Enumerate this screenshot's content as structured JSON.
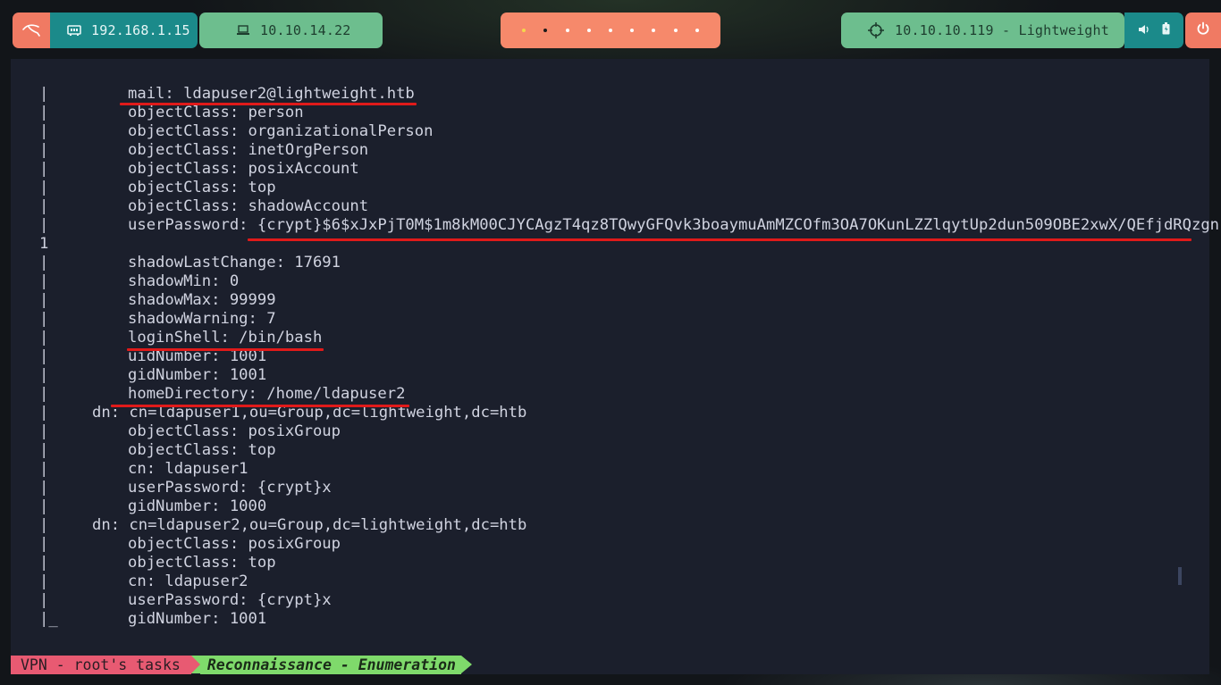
{
  "topbar": {
    "kali_icon": "kali-dragon-icon",
    "local_ip": "192.168.1.15",
    "vpn_ip": "10.10.14.22",
    "workspaces_count": 9,
    "active_workspace": 2,
    "target": "10.10.10.119 - Lightweight",
    "volume_icon": "volume-icon",
    "battery_icon": "battery-icon",
    "power_icon": "power-icon"
  },
  "terminal": {
    "lines": [
      {
        "bar": "|",
        "indent": 2,
        "text": "mail: ldapuser2@lightweight.htb"
      },
      {
        "bar": "|",
        "indent": 2,
        "text": "objectClass: person"
      },
      {
        "bar": "|",
        "indent": 2,
        "text": "objectClass: organizationalPerson"
      },
      {
        "bar": "|",
        "indent": 2,
        "text": "objectClass: inetOrgPerson"
      },
      {
        "bar": "|",
        "indent": 2,
        "text": "objectClass: posixAccount"
      },
      {
        "bar": "|",
        "indent": 2,
        "text": "objectClass: top"
      },
      {
        "bar": "|",
        "indent": 2,
        "text": "objectClass: shadowAccount"
      },
      {
        "bar": "|",
        "indent": 2,
        "text": "userPassword: {crypt}$6$xJxPjT0M$1m8kM00CJYCAgzT4qz8TQwyGFQvk3boaymuAmMZCOfm3OA7OKunLZZlqytUp2dun509OBE2xwX/QEfjdRQzgn"
      },
      {
        "bar": "",
        "indent": 0,
        "text": "1"
      },
      {
        "bar": "|",
        "indent": 2,
        "text": "shadowLastChange: 17691"
      },
      {
        "bar": "|",
        "indent": 2,
        "text": "shadowMin: 0"
      },
      {
        "bar": "|",
        "indent": 2,
        "text": "shadowMax: 99999"
      },
      {
        "bar": "|",
        "indent": 2,
        "text": "shadowWarning: 7"
      },
      {
        "bar": "|",
        "indent": 2,
        "text": "loginShell: /bin/bash"
      },
      {
        "bar": "|",
        "indent": 2,
        "text": "uidNumber: 1001"
      },
      {
        "bar": "|",
        "indent": 2,
        "text": "gidNumber: 1001"
      },
      {
        "bar": "|",
        "indent": 2,
        "text": "homeDirectory: /home/ldapuser2"
      },
      {
        "bar": "|",
        "indent": 1,
        "text": "dn: cn=ldapuser1,ou=Group,dc=lightweight,dc=htb"
      },
      {
        "bar": "|",
        "indent": 2,
        "text": "objectClass: posixGroup"
      },
      {
        "bar": "|",
        "indent": 2,
        "text": "objectClass: top"
      },
      {
        "bar": "|",
        "indent": 2,
        "text": "cn: ldapuser1"
      },
      {
        "bar": "|",
        "indent": 2,
        "text": "userPassword: {crypt}x"
      },
      {
        "bar": "|",
        "indent": 2,
        "text": "gidNumber: 1000"
      },
      {
        "bar": "|",
        "indent": 1,
        "text": "dn: cn=ldapuser2,ou=Group,dc=lightweight,dc=htb"
      },
      {
        "bar": "|",
        "indent": 2,
        "text": "objectClass: posixGroup"
      },
      {
        "bar": "|",
        "indent": 2,
        "text": "objectClass: top"
      },
      {
        "bar": "|",
        "indent": 2,
        "text": "cn: ldapuser2"
      },
      {
        "bar": "|",
        "indent": 2,
        "text": "userPassword: {crypt}x"
      },
      {
        "bar": "|_",
        "indent": 2,
        "text": "gidNumber: 1001"
      }
    ],
    "highlight_color": "#e01a1a"
  },
  "statusbar": {
    "session": "VPN - root's tasks",
    "window": "Reconnaissance - Enumeration"
  }
}
